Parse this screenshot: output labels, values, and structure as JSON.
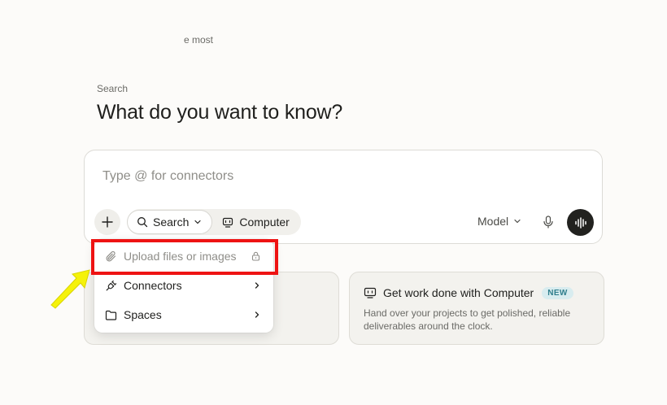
{
  "eyebrow": "Search",
  "headline": "What do you want to know?",
  "composer": {
    "placeholder": "Type @ for connectors",
    "modes": {
      "search_label": "Search",
      "computer_label": "Computer"
    },
    "model_label": "Model"
  },
  "menu": {
    "items": [
      {
        "label": "Upload files or images",
        "icon": "paperclip-icon",
        "state": "disabled"
      },
      {
        "label": "Connectors",
        "icon": "plug-icon"
      },
      {
        "label": "Spaces",
        "icon": "folder-icon"
      }
    ]
  },
  "cards": {
    "left_text": "e most",
    "right": {
      "title": "Get work done with Computer",
      "badge": "NEW",
      "description": "Hand over your projects to get polished, reliable deliverables around the clock."
    }
  },
  "annotation": {
    "highlight_color": "#ee1313",
    "arrow_color": "#f5f20a"
  }
}
